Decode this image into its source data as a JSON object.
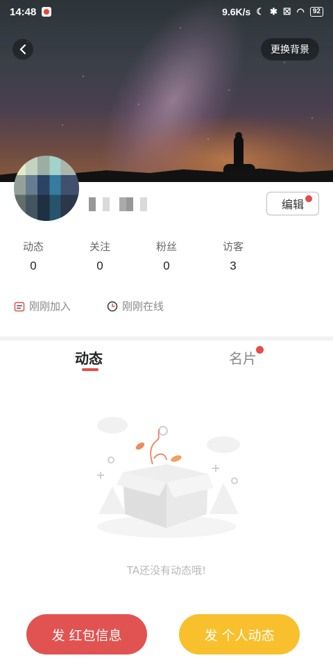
{
  "status_bar": {
    "time": "14:48",
    "net_speed": "9.6K/s",
    "battery": "92"
  },
  "header": {
    "change_background": "更换背景"
  },
  "profile": {
    "edit_label": "编辑"
  },
  "stats": [
    {
      "label": "动态",
      "value": "0"
    },
    {
      "label": "关注",
      "value": "0"
    },
    {
      "label": "粉丝",
      "value": "0"
    },
    {
      "label": "访客",
      "value": "3"
    }
  ],
  "meta": {
    "joined": "刚刚加入",
    "online": "刚刚在线"
  },
  "tabs": {
    "active": "动态",
    "other": "名片"
  },
  "empty": {
    "message": "TA还没有动态哦!"
  },
  "actions": {
    "red_packet": "发 红包信息",
    "personal_post": "发 个人动态"
  },
  "colors": {
    "accent_red": "#e15351",
    "accent_yellow": "#f8c02d",
    "badge_red": "#e64b4b"
  }
}
